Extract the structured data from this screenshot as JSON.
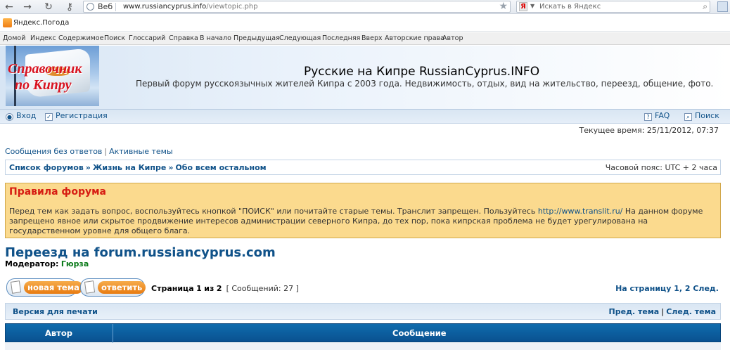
{
  "browser": {
    "tab_label": "Веб",
    "url_host": "www.russiancyprus.info",
    "url_path": "/viewtopic.php",
    "search_placeholder": "Искать в Яндекс",
    "bookmark": "Яндекс.Погода"
  },
  "linkbar": [
    "Домой",
    "Индекс",
    "Содержимое",
    "Поиск",
    "Глоссарий",
    "Справка",
    "В начало",
    "Предыдущая",
    "Следующая",
    "Последняя",
    "Вверх",
    "Авторские права",
    "Автор"
  ],
  "logo": {
    "line1": "Справочник",
    "line2": "по Кипру"
  },
  "site": {
    "title": "Русские на Кипре RussianCyprus.INFO",
    "description": "Первый форум русскоязычных жителей Кипра с 2003 года. Недвижимость, отдых, вид на жительство, переезд, общение, фото."
  },
  "userbar": {
    "login": "Вход",
    "register": "Регистрация",
    "faq": "FAQ",
    "search": "Поиск"
  },
  "current_time": "Текущее время: 25/11/2012, 07:37",
  "quicklinks": {
    "unanswered": "Сообщения без ответов",
    "active": "Активные темы"
  },
  "breadcrumbs": [
    "Список форумов",
    "Жизнь на Кипре",
    "Обо всем остальном"
  ],
  "timezone": "Часовой пояс: UTC + 2 часа",
  "rules": {
    "title": "Правила форума",
    "text_before": "Перед тем как задать вопрос, воспользуйтесь кнопкой \"ПОИСК\" или почитайте старые темы. Транслит запрещен. Пользуйтесь ",
    "link": "http://www.translit.ru/",
    "text_after": " На данном форуме запрещено явное или скрытое продвижение интересов администрации северного Кипра, до тех пор, пока кипрская проблема не будет урегулирована на государственном уровне для общего блага."
  },
  "topic": {
    "title": "Переезд на forum.russiancyprus.com",
    "moderator_label": "Модератор:",
    "moderator_name": "Гюрза"
  },
  "buttons": {
    "new_topic": "новая тема",
    "reply": "ответить"
  },
  "pagination": {
    "label": "Страница",
    "current": "1",
    "of": "из",
    "total": "2",
    "posts": "[ Сообщений: 27 ]",
    "to_page": "На страницу 1, 2  След."
  },
  "print_bar": {
    "print": "Версия для печати",
    "prev": "Пред. тема",
    "next": "След. тема"
  },
  "table": {
    "author_header": "Автор",
    "message_header": "Сообщение"
  },
  "colors": {
    "link": "#105289",
    "rules_bg": "#fbda8e",
    "rules_title": "#d61c12",
    "header_bar": "#0a5190"
  }
}
